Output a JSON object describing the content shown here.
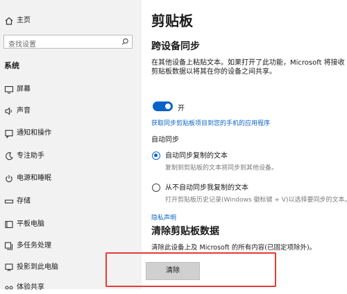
{
  "sidebar": {
    "home_label": "主页",
    "search_placeholder": "查找设置",
    "section_title": "系统",
    "items": [
      {
        "label": "屏幕",
        "icon": "monitor-icon"
      },
      {
        "label": "声音",
        "icon": "speaker-icon"
      },
      {
        "label": "通知和操作",
        "icon": "notification-icon"
      },
      {
        "label": "专注助手",
        "icon": "moon-icon"
      },
      {
        "label": "电源和睡眠",
        "icon": "power-icon"
      },
      {
        "label": "存储",
        "icon": "storage-icon"
      },
      {
        "label": "平板电脑",
        "icon": "tablet-icon"
      },
      {
        "label": "多任务处理",
        "icon": "multitask-icon"
      },
      {
        "label": "投影到此电脑",
        "icon": "project-icon"
      },
      {
        "label": "体验共享",
        "icon": "share-icon"
      }
    ]
  },
  "content": {
    "page_title": "剪贴板",
    "sync": {
      "heading": "跨设备同步",
      "description": "在其他设备上粘贴文本。如果打开了此功能，Microsoft 将接收剪贴板数据以将其在你的设备之间共享。",
      "toggle_state": "开",
      "link": "获取同步剪贴板项目到您的手机的应用程序",
      "auto_sync_label": "自动同步",
      "option1_label": "自动同步复制的文本",
      "option1_desc": "复制到剪贴板的文本将同步到其他设备。",
      "option2_label": "从不自动同步我复制的文本",
      "option2_desc": "打开剪贴板历史记录(Windows 徽标键 + V)以选择要同步的文本。",
      "privacy_link": "隐私声明"
    },
    "clear": {
      "heading": "清除剪贴板数据",
      "description": "清除此设备上及 Microsoft 的所有内容(已固定项除外)。",
      "button_label": "清除"
    }
  },
  "colors": {
    "accent": "#0a64c8",
    "highlight": "#e53935"
  }
}
